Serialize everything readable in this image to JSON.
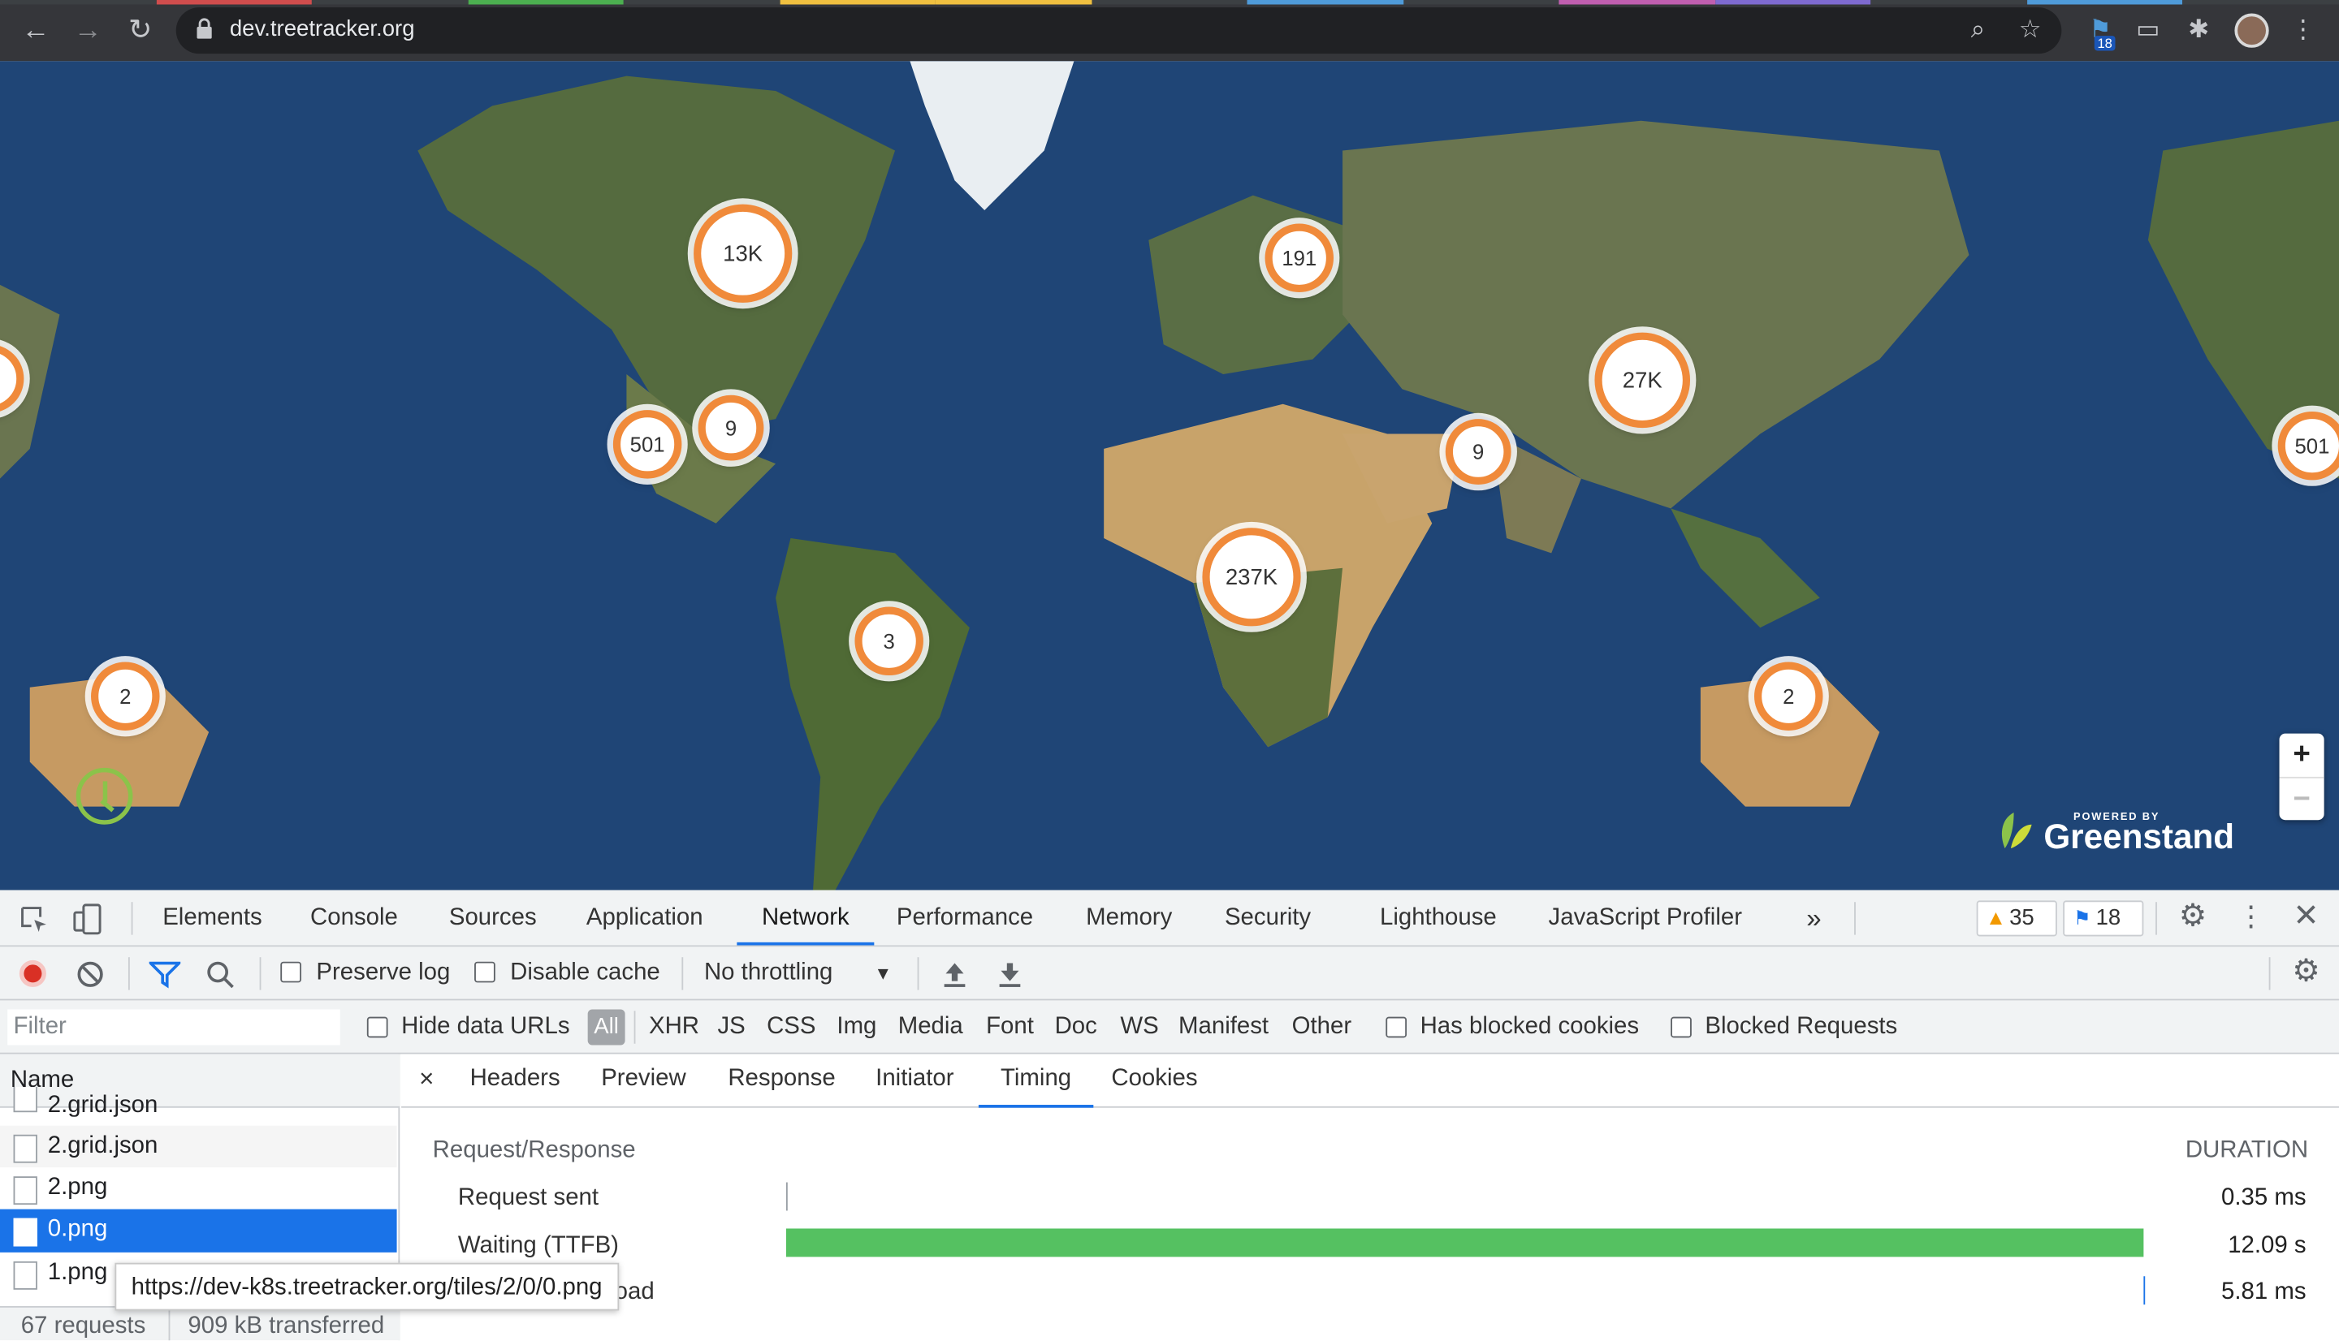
{
  "browser": {
    "url": "dev.treetracker.org",
    "extension_badge": "18",
    "icons": [
      "back-icon",
      "forward-icon",
      "reload-icon",
      "lock-icon",
      "zoom-icon",
      "star-icon",
      "extension-icon",
      "cast-icon",
      "puzzle-icon",
      "profile-avatar",
      "more-icon"
    ]
  },
  "map": {
    "clusters": [
      {
        "label": "13K"
      },
      {
        "label": "191"
      },
      {
        "label": "27K"
      },
      {
        "label": "501"
      },
      {
        "label": "9"
      },
      {
        "label": "9"
      },
      {
        "label": "237K"
      },
      {
        "label": "3"
      },
      {
        "label": "2"
      },
      {
        "label": "2"
      },
      {
        "label": "501"
      },
      {
        "label": ""
      }
    ],
    "zoom_in": "+",
    "zoom_out": "−",
    "brand_powered": "POWERED BY",
    "brand_name": "Greenstand"
  },
  "devtools": {
    "tabs": [
      "Elements",
      "Console",
      "Sources",
      "Application",
      "Network",
      "Performance",
      "Memory",
      "Security",
      "Lighthouse",
      "JavaScript Profiler"
    ],
    "active_tab": "Network",
    "more_tabs": "»",
    "warnings_count": "35",
    "messages_count": "18",
    "toolbar": {
      "preserve_log": "Preserve log",
      "disable_cache": "Disable cache",
      "throttling": "No throttling"
    },
    "filter": {
      "placeholder": "Filter",
      "hide_data_urls": "Hide data URLs",
      "types": [
        "All",
        "XHR",
        "JS",
        "CSS",
        "Img",
        "Media",
        "Font",
        "Doc",
        "WS",
        "Manifest",
        "Other"
      ],
      "has_blocked_cookies": "Has blocked cookies",
      "blocked_requests": "Blocked Requests"
    },
    "requests": {
      "column_name": "Name",
      "rows": [
        "2.grid.json",
        "2.grid.json",
        "2.png",
        "0.png",
        "1.png"
      ],
      "selected": "0.png",
      "summary_requests": "67 requests",
      "summary_transferred": "909 kB transferred"
    },
    "tooltip": "https://dev-k8s.treetracker.org/tiles/2/0/0.png",
    "detail": {
      "close": "×",
      "tabs": [
        "Headers",
        "Preview",
        "Response",
        "Initiator",
        "Timing",
        "Cookies"
      ],
      "active_tab": "Timing",
      "section_title": "Request/Response",
      "duration_header": "DURATION",
      "timing": [
        {
          "label": "Request sent",
          "value": "0.35 ms"
        },
        {
          "label": "Waiting (TTFB)",
          "value": "12.09 s"
        },
        {
          "label": "Content Download",
          "value": "5.81 ms"
        }
      ]
    }
  }
}
